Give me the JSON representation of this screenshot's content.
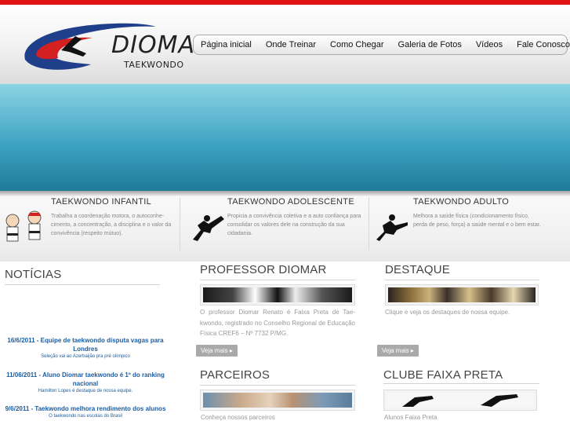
{
  "header": {
    "logo_word": "DIOMAR",
    "logo_sub": "TAEKWONDO",
    "nav": [
      "Página inicial",
      "Onde Treinar",
      "Como Chegar",
      "Galeria de Fotos",
      "Vídeos",
      "Fale Conosco"
    ]
  },
  "features": [
    {
      "title": "TAEKWONDO INFANTIL",
      "text": "Trabalha a coordenação motora, o autoconhe-cimento, a concentração, a disciplina e o valor da convivência (respeito mútuo)."
    },
    {
      "title": "TAEKWONDO ADOLESCENTE",
      "text": "Propicia a convivência coletiva e a auto confiança para consolidar os valores dele na construção da sua cidadania."
    },
    {
      "title": "TAEKWONDO ADULTO",
      "text": "Melhora a saúde física (condicionamento físico, perda de peso, força) a saúde mental e o bem estar."
    }
  ],
  "noticias": {
    "title": "NOTÍCIAS",
    "items": [
      {
        "title": "16/6/2011 - Equipe de taekwondo disputa vagas para Londres",
        "sub": "Seleção vai ao Azerbaijão pra pré olímpico"
      },
      {
        "title": "11/06/2011 - Aluno Diomar taekwondo é 1º do ranking nacional",
        "sub": "Hamilton Lopes é destaque de nossa equipe."
      },
      {
        "title": "9/6/2011 - Taekwondo melhora rendimento dos alunos",
        "sub": "O taekwondo nas escolas do Brasil"
      }
    ]
  },
  "professor": {
    "title": "PROFESSOR DIOMAR",
    "text": "O professor Diomar Renato é Faixa Preta de Tae-kwondo, registrado no Conselho Regional de Educação Física CREF6 – Nº 7732 P/MG.",
    "more": "Veja mais"
  },
  "destaque": {
    "title": "DESTAQUE",
    "text": "Clique e veja os destaques de nossa equipe.",
    "more": "Veja mais"
  },
  "parceiros": {
    "title": "PARCEIROS",
    "text": "Conheça nossos parceiros"
  },
  "clube": {
    "title": "CLUBE FAIXA PRETA",
    "text": "Alunos Faixa Preta"
  },
  "colors": {
    "accent_red": "#e01414",
    "logo_blue": "#1f3f8a",
    "news_blue": "#1c5da0",
    "banner_teal": "#3fa4c3"
  }
}
